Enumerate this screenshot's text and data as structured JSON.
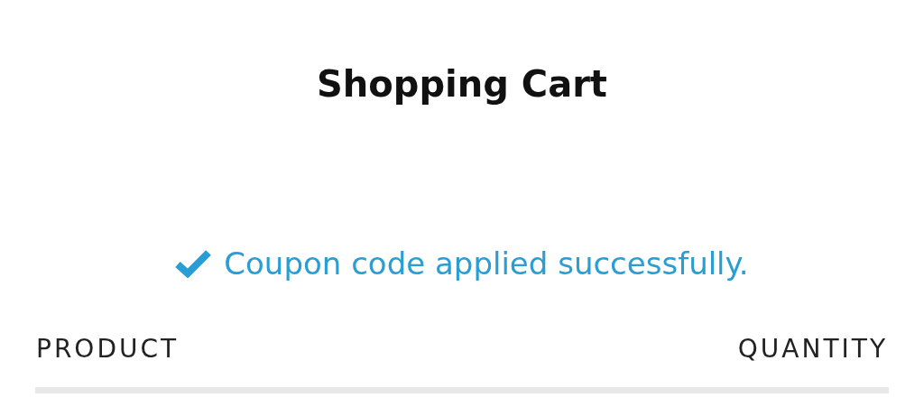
{
  "title": "Shopping Cart",
  "notice": {
    "kind": "success",
    "text": "Coupon code applied successfully."
  },
  "table": {
    "columns": [
      {
        "label": "PRODUCT"
      },
      {
        "label": "QUANTITY"
      }
    ]
  }
}
